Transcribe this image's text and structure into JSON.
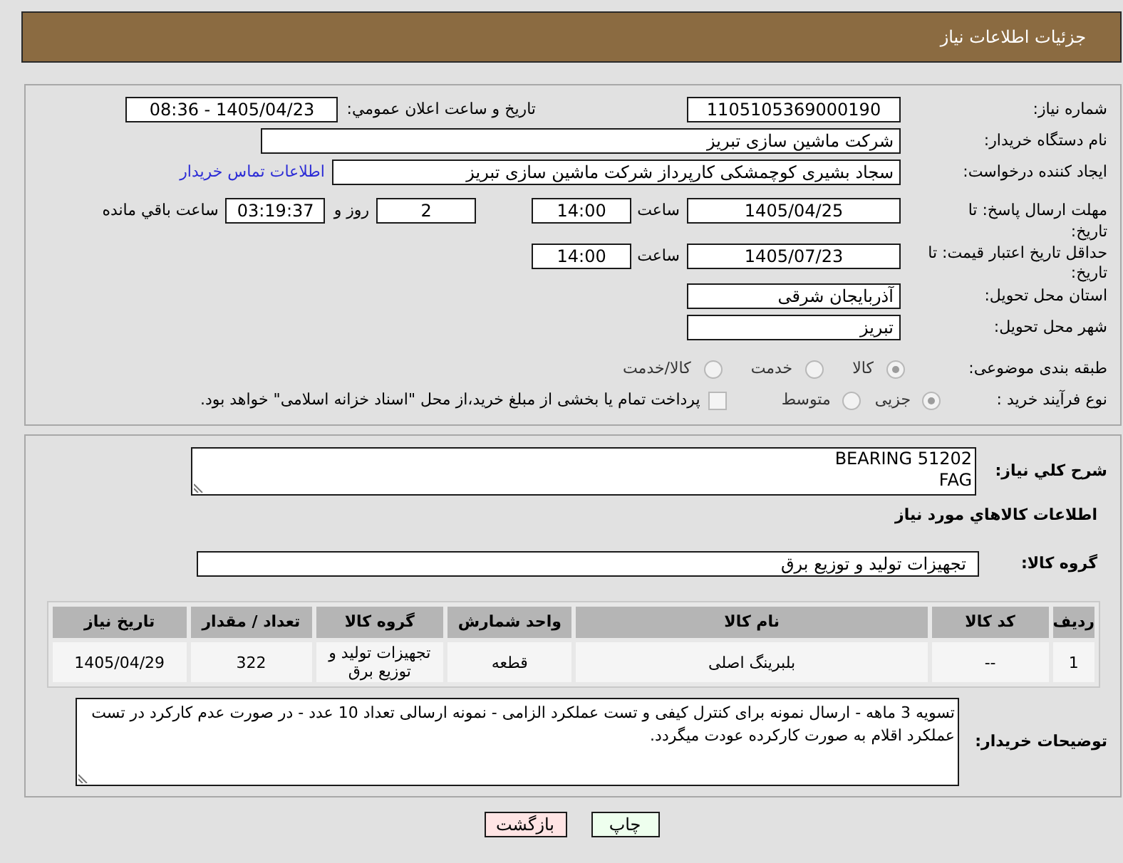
{
  "header": {
    "title": "جزئیات اطلاعات نیاز"
  },
  "details": {
    "need_number": {
      "label": "شماره نیاز:",
      "value": "1105105369000190"
    },
    "announcement": {
      "label": "تاریخ و ساعت اعلان عمومي:",
      "value": "1405/04/23 - 08:36"
    },
    "buyer_org": {
      "label": "نام دستگاه خریدار:",
      "value": "شرکت ماشین سازی تبریز"
    },
    "requester": {
      "label": "ایجاد کننده درخواست:",
      "value": "سجاد بشیری کوچمشکی کارپرداز شرکت ماشین سازی تبریز",
      "link": "اطلاعات تماس خریدار"
    },
    "deadline": {
      "label": "مهلت ارسال پاسخ: تا تاریخ:",
      "date": "1405/04/25",
      "time_label": "ساعت",
      "time": "14:00",
      "days": "2",
      "days_label": "روز و",
      "remaining": "03:19:37",
      "remaining_label": "ساعت باقي مانده"
    },
    "price_validity": {
      "label": "حداقل تاریخ اعتبار قیمت: تا تاریخ:",
      "date": "1405/07/23",
      "time_label": "ساعت",
      "time": "14:00"
    },
    "province": {
      "label": "استان محل تحویل:",
      "value": "آذربایجان شرقی"
    },
    "city": {
      "label": "شهر محل تحویل:",
      "value": "تبریز"
    },
    "category": {
      "label": "طبقه بندی موضوعی:",
      "options": [
        {
          "label": "کالا",
          "selected": true
        },
        {
          "label": "خدمت",
          "selected": false
        },
        {
          "label": "کالا/خدمت",
          "selected": false
        }
      ]
    },
    "process": {
      "label": "نوع فرآیند خرید :",
      "options": [
        {
          "label": "جزیی",
          "selected": true
        },
        {
          "label": "متوسط",
          "selected": false
        }
      ],
      "treasury": {
        "label": "پرداخت تمام یا بخشی از مبلغ خرید،از محل \"اسناد خزانه اسلامی\" خواهد بود.",
        "checked": false
      }
    }
  },
  "summary": {
    "label": "شرح کلي نیاز:",
    "value": "BEARING 51202\nFAG"
  },
  "goods": {
    "title": "اطلاعات کالاهاي مورد نیاز",
    "group_label": "گروه کالا:",
    "group_value": "تجهیزات تولید و توزیع برق",
    "table": {
      "columns": [
        "ردیف",
        "کد کالا",
        "نام کالا",
        "واحد شمارش",
        "گروه کالا",
        "تعداد / مقدار",
        "تاریخ نیاز"
      ],
      "rows": [
        [
          "1",
          "--",
          "بلبرینگ اصلی",
          "قطعه",
          "تجهیزات تولید و توزیع برق",
          "322",
          "1405/04/29"
        ]
      ]
    }
  },
  "buyer_notes": {
    "label": "توضیحات خریدار:",
    "value": "تسویه 3 ماهه - ارسال نمونه برای کنترل کیفی و تست عملکرد الزامی - نمونه ارسالی تعداد 10 عدد - در صورت عدم کارکرد در تست عملکرد اقلام به صورت کارکرده عودت میگردد."
  },
  "buttons": [
    {
      "label": "چاپ",
      "kind": "print"
    },
    {
      "label": "بازگشت",
      "kind": "back"
    }
  ]
}
